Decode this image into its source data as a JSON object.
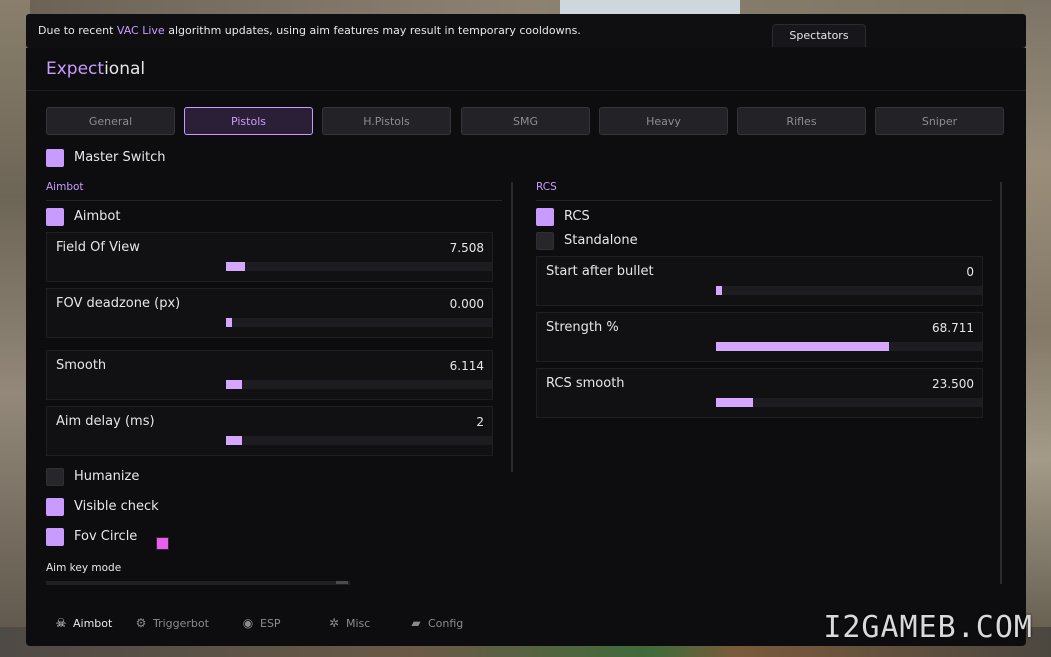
{
  "notice": {
    "prefix": "Due to recent",
    "highlight": "VAC Live",
    "suffix": "algorithm updates, using aim features may result in temporary cooldowns."
  },
  "spectators_label": "Spectators",
  "brand": {
    "accent": "Expect",
    "rest": "ional"
  },
  "tabs": [
    {
      "label": "General",
      "active": false
    },
    {
      "label": "Pistols",
      "active": true
    },
    {
      "label": "H.Pistols",
      "active": false
    },
    {
      "label": "SMG",
      "active": false
    },
    {
      "label": "Heavy",
      "active": false
    },
    {
      "label": "Rifles",
      "active": false
    },
    {
      "label": "Sniper",
      "active": false
    }
  ],
  "master_switch": {
    "label": "Master Switch",
    "checked": true
  },
  "aimbot": {
    "title": "Aimbot",
    "toggle": {
      "label": "Aimbot",
      "checked": true
    },
    "sliders": [
      {
        "label": "Field Of View",
        "value": "7.508",
        "fraction": 0.07
      },
      {
        "label": "FOV deadzone (px)",
        "value": "0.000",
        "fraction": 0.0
      },
      {
        "label": "Smooth",
        "value": "6.114",
        "fraction": 0.06
      },
      {
        "label": "Aim delay (ms)",
        "value": "2",
        "fraction": 0.06
      }
    ],
    "humanize": {
      "label": "Humanize",
      "checked": false
    },
    "visible_check": {
      "label": "Visible check",
      "checked": true
    },
    "fov_circle": {
      "label": "Fov Circle",
      "checked": true,
      "color": "#ec5cf0"
    },
    "aim_key_mode_label": "Aim key mode"
  },
  "rcs": {
    "title": "RCS",
    "toggle": {
      "label": "RCS",
      "checked": true
    },
    "standalone": {
      "label": "Standalone",
      "checked": false
    },
    "sliders": [
      {
        "label": "Start after bullet",
        "value": "0",
        "fraction": 0.0
      },
      {
        "label": "Strength %",
        "value": "68.711",
        "fraction": 0.65
      },
      {
        "label": "RCS smooth",
        "value": "23.500",
        "fraction": 0.14
      }
    ]
  },
  "nav": [
    {
      "label": "Aimbot",
      "icon": "skull-icon",
      "glyph": "☠",
      "active": true
    },
    {
      "label": "Triggerbot",
      "icon": "gear-icon",
      "glyph": "⚙",
      "active": false
    },
    {
      "label": "ESP",
      "icon": "eye-icon",
      "glyph": "◉",
      "active": false
    },
    {
      "label": "Misc",
      "icon": "misc-icon",
      "glyph": "✲",
      "active": false
    },
    {
      "label": "Config",
      "icon": "folder-icon",
      "glyph": "▰",
      "active": false
    }
  ],
  "watermark": "I2GAMEB.COM",
  "colors": {
    "accent": "#c99bff",
    "fill": "#d6a7ff",
    "panel": "#0d0d10"
  }
}
